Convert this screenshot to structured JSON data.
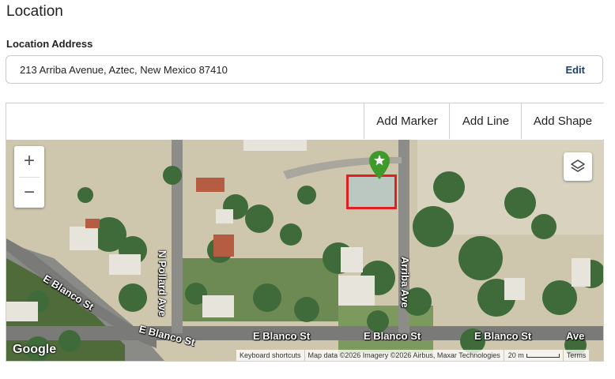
{
  "section": {
    "title": "Location"
  },
  "address": {
    "label": "Location Address",
    "value": "213 Arriba Avenue, Aztec, New Mexico 87410",
    "edit_label": "Edit"
  },
  "toolbar": {
    "add_marker": "Add Marker",
    "add_line": "Add Line",
    "add_shape": "Add Shape"
  },
  "map": {
    "zoom_in": "+",
    "zoom_out": "−",
    "streets": [
      "N Pollard Ave",
      "Arriba Ave",
      "E Blanco St",
      "E Blanco St",
      "E Blanco St",
      "E Blanco St",
      "E Blanco St",
      "E Blanco St",
      "Ave",
      "Terms"
    ],
    "google": "Google",
    "attribution": {
      "shortcuts": "Keyboard shortcuts",
      "data": "Map data ©2026 Imagery ©2026 Airbus, Maxar Technologies",
      "scale": "20 m",
      "terms": "Terms"
    },
    "marker_color": "#3f9a2b",
    "selection_color": "#e02020"
  }
}
